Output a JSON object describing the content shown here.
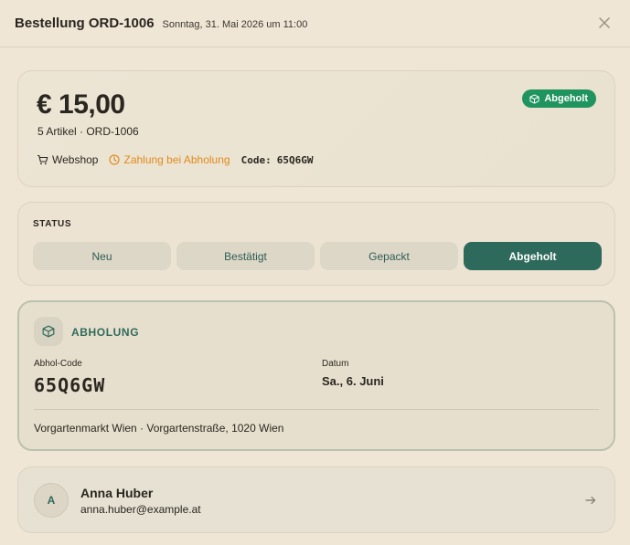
{
  "header": {
    "title": "Bestellung ORD-1006",
    "subtitle": "Sonntag, 31. Mai 2026 um 11:00",
    "close_icon": "close-icon"
  },
  "summary": {
    "amount": "€ 15,00",
    "items_line": "5 Artikel · ORD-1006",
    "badge": "Abgeholt",
    "badge_color": "#20945e",
    "source": "Webshop",
    "payment": "Zahlung bei Abholung",
    "payment_color": "#e08a1e",
    "code_label": "Code:",
    "code": "65Q6GW"
  },
  "status": {
    "label": "STATUS",
    "steps": [
      "Neu",
      "Bestätigt",
      "Gepackt",
      "Abgeholt"
    ],
    "active": "Abgeholt",
    "active_color": "#2e6a5b"
  },
  "pickup": {
    "title": "ABHOLUNG",
    "code_label": "Abhol-Code",
    "code": "65Q6GW",
    "date_label": "Datum",
    "date": "Sa., 6. Juni",
    "address": "Vorgartenmarkt Wien · Vorgartenstraße, 1020 Wien"
  },
  "customer": {
    "initial": "A",
    "name": "Anna Huber",
    "email": "anna.huber@example.at"
  }
}
